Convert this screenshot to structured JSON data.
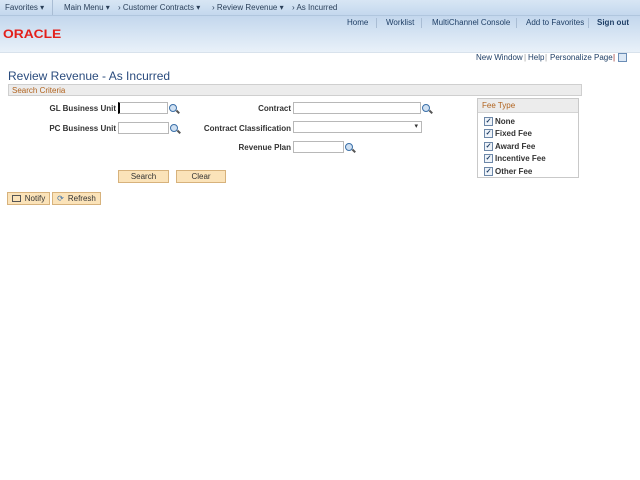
{
  "nav": {
    "favorites": "Favorites",
    "main_menu": "Main Menu",
    "crumbs": [
      "Customer Contracts",
      "Review Revenue",
      "As Incurred"
    ]
  },
  "header": {
    "links": [
      "Home",
      "Worklist",
      "MultiChannel Console",
      "Add to Favorites",
      "Sign out"
    ],
    "logo": "ORACLE"
  },
  "pagebar": {
    "new_window": "New Window",
    "help": "Help",
    "personalize": "Personalize Page"
  },
  "page": {
    "title": "Review Revenue - As Incurred",
    "section": "Search Criteria"
  },
  "form": {
    "gl_bu": "GL Business Unit",
    "pc_bu": "PC Business Unit",
    "contract": "Contract",
    "classification": "Contract Classification",
    "revenue_plan": "Revenue Plan"
  },
  "buttons": {
    "search": "Search",
    "clear": "Clear",
    "notify": "Notify",
    "refresh": "Refresh"
  },
  "fee_type": {
    "title": "Fee Type",
    "items": [
      {
        "label": "None",
        "checked": true
      },
      {
        "label": "Fixed Fee",
        "checked": true
      },
      {
        "label": "Award Fee",
        "checked": true
      },
      {
        "label": "Incentive Fee",
        "checked": true
      },
      {
        "label": "Other Fee",
        "checked": true
      }
    ]
  }
}
